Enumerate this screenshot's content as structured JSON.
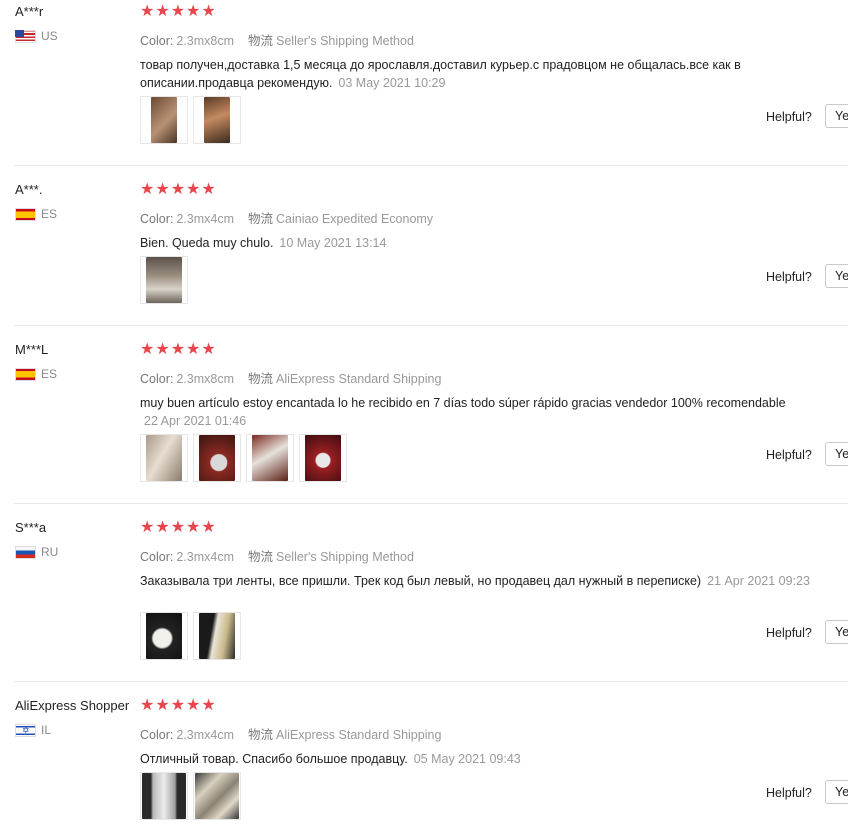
{
  "labels": {
    "color_key": "Color:",
    "shipping_key": "物流",
    "helpful": "Helpful?",
    "yes_button": "Ye",
    "stars": "★★★★★"
  },
  "reviews": [
    {
      "user": "A***r",
      "country": "US",
      "rating": 5,
      "color": "2.3mx8cm",
      "shipping": "Seller's Shipping Method",
      "text": "товар получен,доставка 1,5 месяца до ярославля.доставил курьер.с прадовцом не общалась.все как в описании.продавца рекомендую.",
      "date": "03 May 2021 10:29",
      "photo_count": 2
    },
    {
      "user": "A***.",
      "country": "ES",
      "rating": 5,
      "color": "2.3mx4cm",
      "shipping": "Cainiao Expedited Economy",
      "text": "Bien. Queda muy chulo.",
      "date": "10 May 2021 13:14",
      "photo_count": 1
    },
    {
      "user": "M***L",
      "country": "ES",
      "rating": 5,
      "color": "2.3mx8cm",
      "shipping": "AliExpress Standard Shipping",
      "text": "muy buen artículo estoy encantada lo he recibido en 7 días todo súper rápido gracias vendedor 100% recomendable",
      "date": "22 Apr 2021 01:46",
      "photo_count": 4
    },
    {
      "user": "S***a",
      "country": "RU",
      "rating": 5,
      "color": "2.3mx4cm",
      "shipping": "Seller's Shipping Method",
      "text": "Заказывала три ленты, все пришли. Трек код был левый, но продавец дал нужный в переписке)",
      "date": "21 Apr 2021 09:23",
      "photo_count": 2
    },
    {
      "user": "AliExpress Shopper",
      "country": "IL",
      "rating": 5,
      "color": "2.3mx4cm",
      "shipping": "AliExpress Standard Shipping",
      "text": "Отличный товар. Спасибо большое продавцу.",
      "date": "05 May 2021 09:43",
      "photo_count": 2
    }
  ]
}
